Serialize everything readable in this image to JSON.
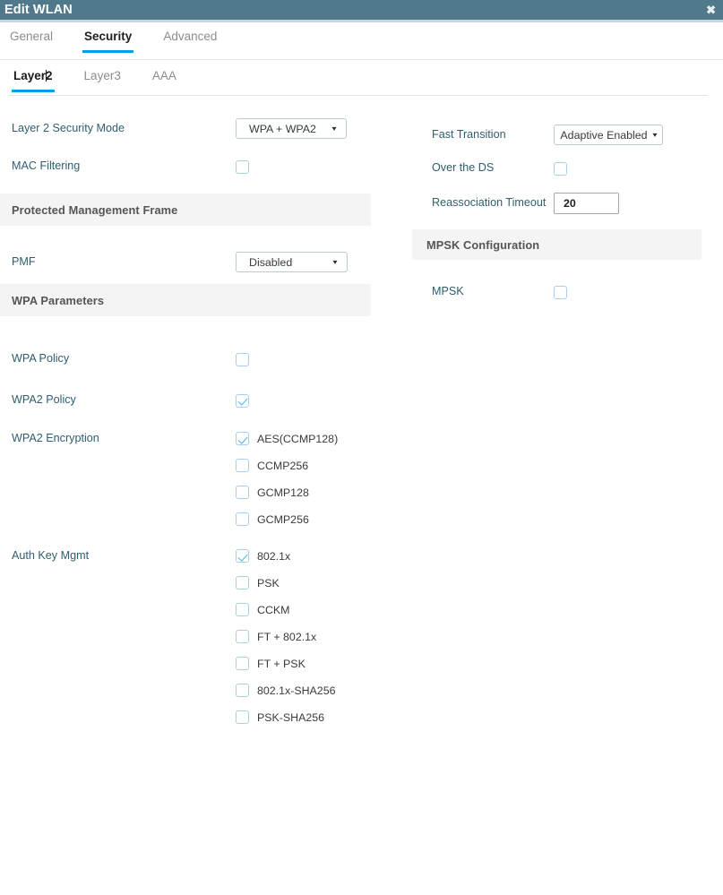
{
  "window": {
    "title": "Edit WLAN",
    "close_icon": "close-icon",
    "close_glyph": "✖"
  },
  "tabs_primary": [
    {
      "label": "General",
      "active": false
    },
    {
      "label": "Security",
      "active": true
    },
    {
      "label": "Advanced",
      "active": false
    }
  ],
  "tabs_secondary": [
    {
      "label_part1": "Layer",
      "label_part2": "2",
      "label": "Layer2",
      "active": true
    },
    {
      "label_part1": "Layer3",
      "label_part2": "",
      "label": "Layer3",
      "active": false
    },
    {
      "label_part1": "AAA",
      "label_part2": "",
      "label": "AAA",
      "active": false
    }
  ],
  "left": {
    "layer2_security_mode": {
      "label": "Layer 2 Security Mode",
      "value": "WPA + WPA2",
      "arrow": "▾"
    },
    "mac_filtering": {
      "label": "MAC Filtering",
      "checked": false
    },
    "pmf_section": {
      "title": "Protected Management Frame"
    },
    "pmf": {
      "label": "PMF",
      "value": "Disabled",
      "arrow": "▾"
    },
    "wpa_section": {
      "title": "WPA Parameters"
    },
    "wpa_policy": {
      "label": "WPA Policy",
      "checked": false
    },
    "wpa2_policy": {
      "label": "WPA2 Policy",
      "checked": true
    },
    "wpa2_encryption": {
      "label": "WPA2 Encryption",
      "options": [
        {
          "label": "AES(CCMP128)",
          "checked": true
        },
        {
          "label": "CCMP256",
          "checked": false
        },
        {
          "label": "GCMP128",
          "checked": false
        },
        {
          "label": "GCMP256",
          "checked": false
        }
      ]
    },
    "auth_key_mgmt": {
      "label": "Auth Key Mgmt",
      "options": [
        {
          "label": "802.1x",
          "checked": true
        },
        {
          "label": "PSK",
          "checked": false
        },
        {
          "label": "CCKM",
          "checked": false
        },
        {
          "label": "FT + 802.1x",
          "checked": false
        },
        {
          "label": "FT + PSK",
          "checked": false
        },
        {
          "label": "802.1x-SHA256",
          "checked": false
        },
        {
          "label": "PSK-SHA256",
          "checked": false
        }
      ]
    }
  },
  "right": {
    "fast_transition": {
      "label": "Fast Transition",
      "value": "Adaptive Enabled",
      "arrow": "▾"
    },
    "over_the_ds": {
      "label": "Over the DS",
      "checked": false
    },
    "reassociation_timeout": {
      "label": "Reassociation Timeout",
      "value": "20"
    },
    "mpsk_section": {
      "title": "MPSK Configuration"
    },
    "mpsk": {
      "label": "MPSK",
      "checked": false
    }
  },
  "colors": {
    "titlebar": "#51798c",
    "accent": "#00a0e4",
    "label": "#2f5e6e",
    "band": "#f4f4f4",
    "checkbox_border": "#a9cef2",
    "check_mark": "#4bb4f0"
  }
}
